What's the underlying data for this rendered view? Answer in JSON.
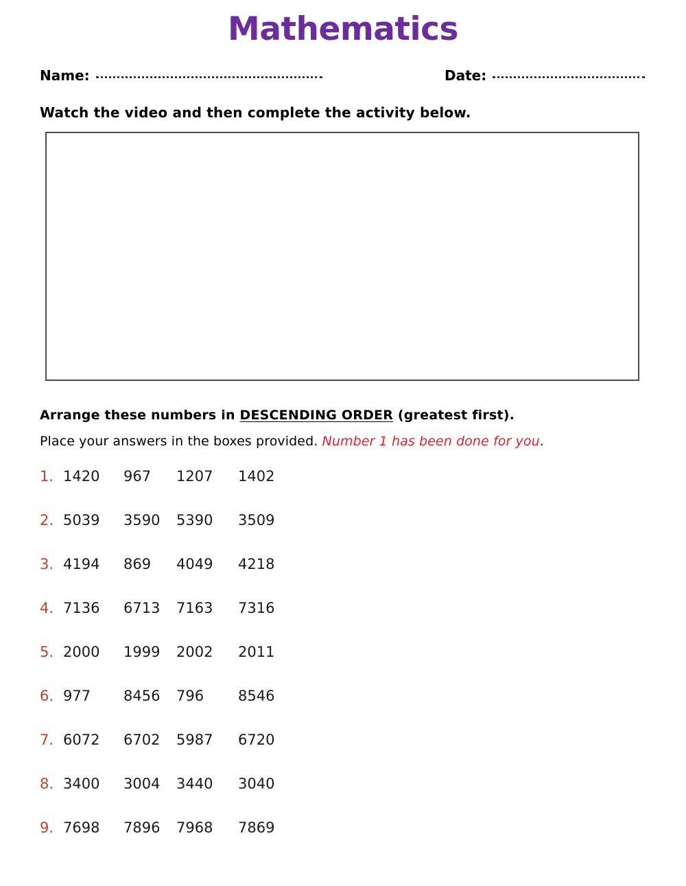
{
  "document": {
    "title": "Mathematics",
    "title_color": "#6B2D9E"
  },
  "header": {
    "name_label": "Name:",
    "date_label": "Date:",
    "name_value": "",
    "date_value": "",
    "name_placeholder": "",
    "date_placeholder": ""
  },
  "intro": {
    "watch_text": "Watch the video and then complete the activity below."
  },
  "video": {
    "caption": ""
  },
  "instructions": {
    "line1_prefix": "Arrange these numbers in ",
    "line1_emphasis": "DESCENDING ORDER",
    "line1_suffix": " (greatest first).",
    "line2_prefix": "Place your answers in the boxes provided. ",
    "line2_red": "Number 1 has been done for you",
    "line2_suffix": ".",
    "red_color": "#E8202A",
    "index_color": "#C0442A"
  },
  "exercises": [
    {
      "index": "1.",
      "values": [
        "1420",
        "967",
        "1207",
        "1402"
      ]
    },
    {
      "index": "2.",
      "values": [
        "5039",
        "3590",
        "5390",
        "3509"
      ]
    },
    {
      "index": "3.",
      "values": [
        "4194",
        "869",
        "4049",
        "4218"
      ]
    },
    {
      "index": "4.",
      "values": [
        "7136",
        "6713",
        "7163",
        "7316"
      ]
    },
    {
      "index": "5.",
      "values": [
        "2000",
        "1999",
        "2002",
        "2011"
      ]
    },
    {
      "index": "6.",
      "values": [
        "977",
        "8456",
        "796",
        "8546"
      ]
    },
    {
      "index": "7.",
      "values": [
        "6072",
        "6702",
        "5987",
        "6720"
      ]
    },
    {
      "index": "8.",
      "values": [
        "3400",
        "3004",
        "3440",
        "3040"
      ]
    },
    {
      "index": "9.",
      "values": [
        "7698",
        "7896",
        "7968",
        "7869"
      ]
    }
  ]
}
